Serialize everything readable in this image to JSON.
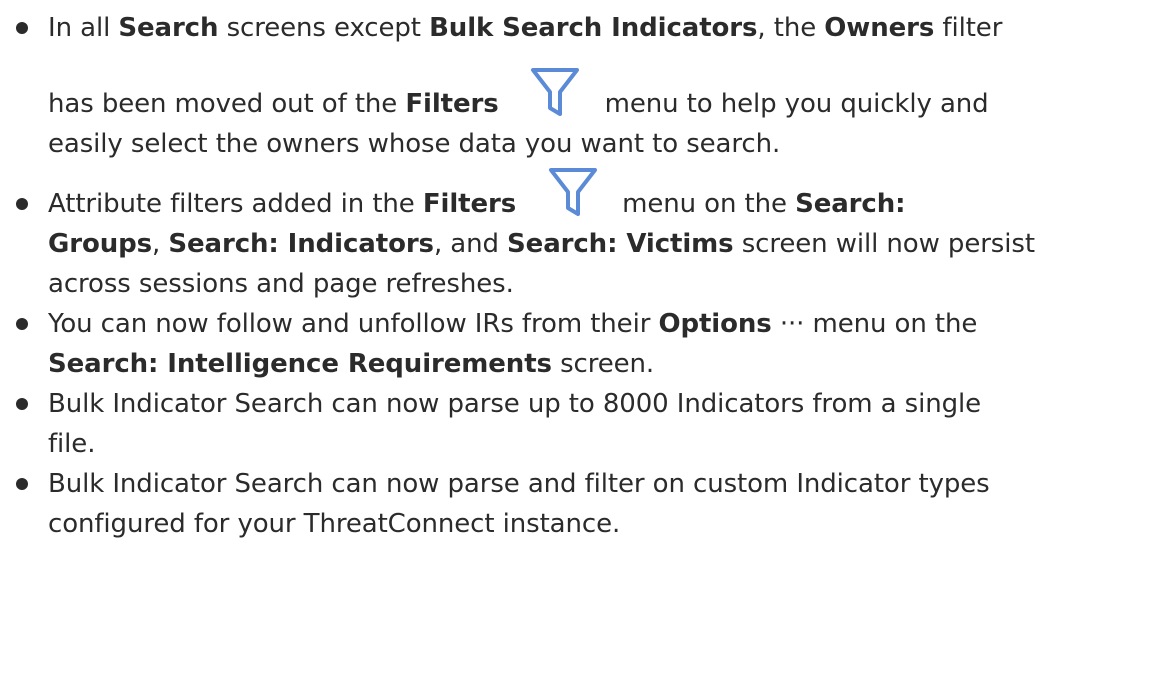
{
  "bullets": [
    {
      "lines": [
        [
          {
            "t": "In all ",
            "b": false
          },
          {
            "t": "Search",
            "b": true
          },
          {
            "t": " screens except ",
            "b": false
          },
          {
            "t": "Bulk Search Indicators",
            "b": true
          },
          {
            "t": ", the ",
            "b": false
          },
          {
            "t": "Owners",
            "b": true
          },
          {
            "t": " filter",
            "b": false
          }
        ],
        [
          {
            "t": "has been moved out of the ",
            "b": false
          },
          {
            "t": "Filters",
            "b": true
          },
          {
            "t": "",
            "b": false,
            "icon": true
          },
          {
            "t": "menu to help you quickly and",
            "b": false
          }
        ],
        [
          {
            "t": "easily select the owners whose data you want to search.",
            "b": false
          }
        ]
      ]
    },
    {
      "lines": [
        [
          {
            "t": "Attribute filters added in the ",
            "b": false
          },
          {
            "t": "Filters",
            "b": true
          },
          {
            "t": "",
            "b": false,
            "icon": true
          },
          {
            "t": "menu on the ",
            "b": false
          },
          {
            "t": "Search:",
            "b": true
          }
        ],
        [
          {
            "t": "Groups",
            "b": true
          },
          {
            "t": ", ",
            "b": false
          },
          {
            "t": "Search: Indicators",
            "b": true
          },
          {
            "t": ", and ",
            "b": false
          },
          {
            "t": "Search: Victims",
            "b": true
          },
          {
            "t": " screen will now persist",
            "b": false
          }
        ],
        [
          {
            "t": "across sessions and page refreshes.",
            "b": false
          }
        ]
      ]
    },
    {
      "lines": [
        [
          {
            "t": "You can now follow and unfollow IRs from their ",
            "b": false
          },
          {
            "t": "Options",
            "b": true
          },
          {
            "t": " ··· menu on the",
            "b": false
          }
        ],
        [
          {
            "t": "Search: Intelligence Requirements",
            "b": true
          },
          {
            "t": " screen.",
            "b": false
          }
        ]
      ]
    },
    {
      "lines": [
        [
          {
            "t": "Bulk Indicator Search can now parse up to 8000 Indicators from a single",
            "b": false
          }
        ],
        [
          {
            "t": "file.",
            "b": false
          }
        ]
      ]
    },
    {
      "lines": [
        [
          {
            "t": "Bulk Indicator Search can now parse and filter on custom Indicator types",
            "b": false
          }
        ],
        [
          {
            "t": "configured for your ThreatConnect instance.",
            "b": false
          }
        ]
      ]
    }
  ],
  "icons": {
    "filter": "filter-funnel-icon",
    "filter_color": "#5b8bd6"
  }
}
